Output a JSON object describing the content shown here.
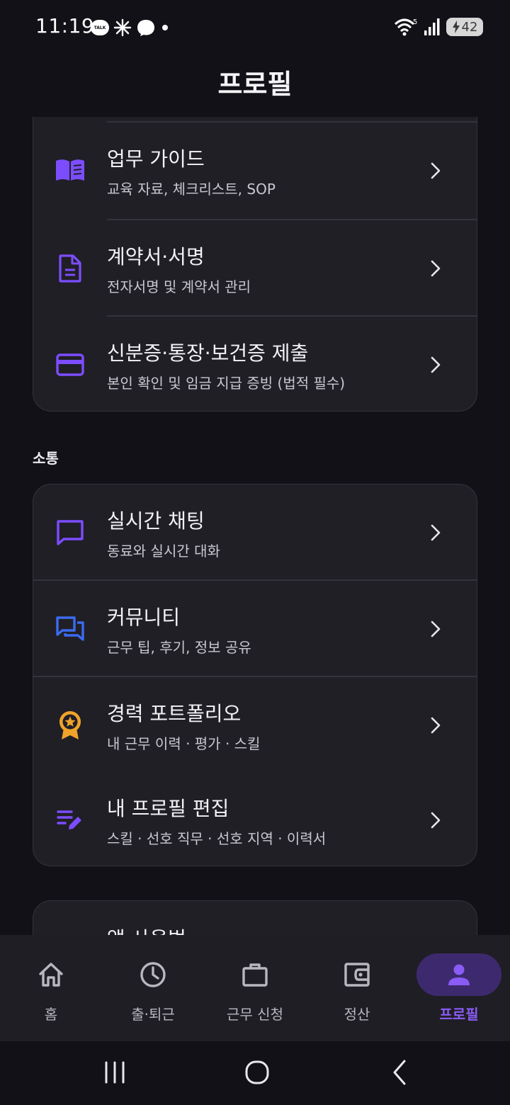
{
  "status_bar": {
    "time": "11:19",
    "notification_icons": [
      "talk-icon",
      "sparkle-icon",
      "messenger-icon",
      "dot-icon"
    ],
    "talk_icon_text": "TALK",
    "wifi_label": "5",
    "battery_level": "42"
  },
  "header": {
    "title": "프로필"
  },
  "section_work": {
    "items": [
      {
        "icon": "book-icon",
        "title": "업무 가이드",
        "subtitle": "교육 자료, 체크리스트, SOP"
      },
      {
        "icon": "document-icon",
        "title": "계약서·서명",
        "subtitle": "전자서명 및 계약서 관리"
      },
      {
        "icon": "credit-card-icon",
        "title": "신분증·통장·보건증 제출",
        "subtitle": "본인 확인 및 임금 지급 증빙 (법적 필수)"
      }
    ]
  },
  "section_communication": {
    "label": "소통",
    "items": [
      {
        "icon": "chat-icon",
        "title": "실시간 채팅",
        "subtitle": "동료와 실시간 대화"
      },
      {
        "icon": "forum-icon",
        "title": "커뮤니티",
        "subtitle": "근무 팁, 후기, 정보 공유"
      },
      {
        "icon": "award-icon",
        "title": "경력 포트폴리오",
        "subtitle": "내 근무 이력 · 평가 · 스킬"
      },
      {
        "icon": "edit-list-icon",
        "title": "내 프로필 편집",
        "subtitle": "스킬 · 선호 직무 · 선호 지역 · 이력서"
      }
    ]
  },
  "section_app": {
    "items": [
      {
        "title": "앱 사용법"
      }
    ]
  },
  "bottom_nav": {
    "items": [
      {
        "icon": "home-icon",
        "label": "홈",
        "active": false
      },
      {
        "icon": "clock-icon",
        "label": "출·퇴근",
        "active": false
      },
      {
        "icon": "briefcase-icon",
        "label": "근무 신청",
        "active": false
      },
      {
        "icon": "wallet-icon",
        "label": "정산",
        "active": false
      },
      {
        "icon": "person-icon",
        "label": "프로필",
        "active": true
      }
    ]
  },
  "colors": {
    "background": "#121117",
    "card": "#201f26",
    "accent_purple": "#7c4dff",
    "accent_blue": "#3b6cf0",
    "accent_gold": "#f0a32a",
    "active_nav_pill": "#3d2a6e"
  }
}
